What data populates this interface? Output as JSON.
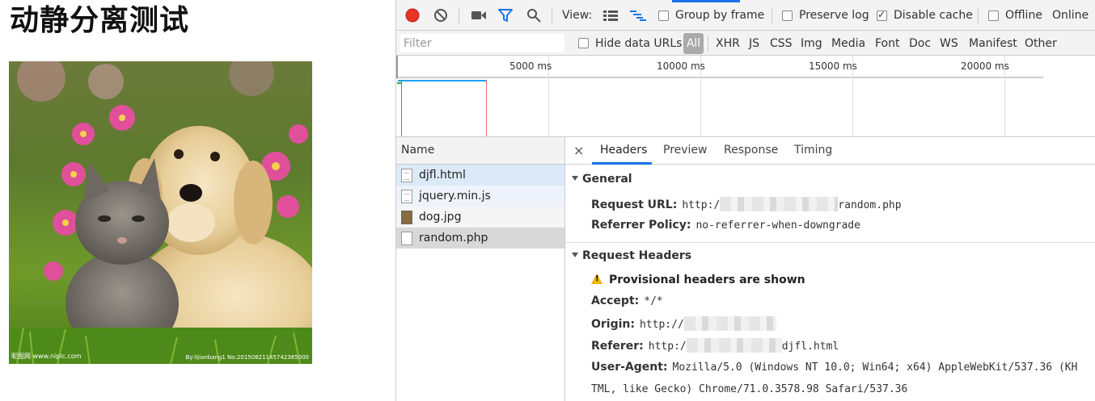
{
  "page": {
    "title": "动静分离测试",
    "image_watermark_left": "昵图网 www.nipic.com",
    "image_watermark_right": "By:lijianbang1 No:20150821145742365000"
  },
  "devtools": {
    "toolbar": {
      "view_label": "View:",
      "group_by_frame": "Group by frame",
      "preserve_log": "Preserve log",
      "disable_cache": "Disable cache",
      "offline": "Offline",
      "online": "Online"
    },
    "filter": {
      "placeholder": "Filter",
      "hide_data_urls": "Hide data URLs",
      "types": [
        "All",
        "XHR",
        "JS",
        "CSS",
        "Img",
        "Media",
        "Font",
        "Doc",
        "WS",
        "Manifest",
        "Other"
      ]
    },
    "timeline": {
      "ticks": [
        "5000 ms",
        "10000 ms",
        "15000 ms",
        "20000 ms"
      ]
    },
    "request_list": {
      "header": "Name",
      "items": [
        "djfl.html",
        "jquery.min.js",
        "dog.jpg",
        "random.php"
      ]
    },
    "detail": {
      "tabs": [
        "Headers",
        "Preview",
        "Response",
        "Timing"
      ],
      "close": "×",
      "general": {
        "title": "General",
        "request_url_label": "Request URL:",
        "request_url_prefix": "http:/",
        "request_url_suffix": "random.php",
        "referrer_policy_label": "Referrer Policy:",
        "referrer_policy_value": "no-referrer-when-downgrade"
      },
      "request_headers": {
        "title": "Request Headers",
        "warning": "Provisional headers are shown",
        "accept_label": "Accept:",
        "accept_value": "*/*",
        "origin_label": "Origin:",
        "origin_value": "http://",
        "referer_label": "Referer:",
        "referer_prefix": "http:/",
        "referer_suffix": "djfl.html",
        "user_agent_label": "User-Agent:",
        "user_agent_line1": "Mozilla/5.0 (Windows NT 10.0; Win64; x64) AppleWebKit/537.36 (KH",
        "user_agent_line2": "TML, like Gecko) Chrome/71.0.3578.98 Safari/537.36"
      }
    }
  }
}
